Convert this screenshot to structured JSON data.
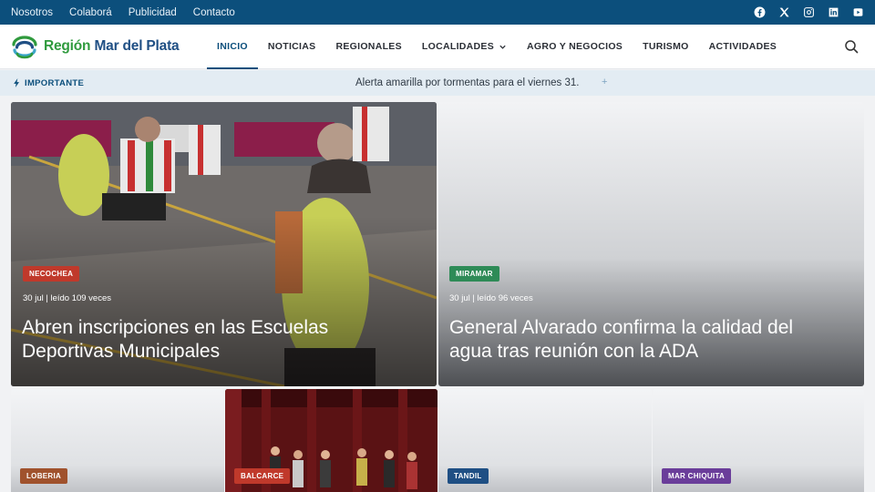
{
  "topbar": {
    "links": [
      "Nosotros",
      "Colaborá",
      "Publicidad",
      "Contacto"
    ],
    "socials": [
      "facebook-icon",
      "x-icon",
      "instagram-icon",
      "linkedin-icon",
      "youtube-icon"
    ]
  },
  "header": {
    "logo_part1": "Región",
    "logo_part2": "Mar del Plata",
    "nav": [
      {
        "label": "INICIO"
      },
      {
        "label": "NOTICIAS"
      },
      {
        "label": "REGIONALES"
      },
      {
        "label": "LOCALIDADES"
      },
      {
        "label": "AGRO Y NEGOCIOS"
      },
      {
        "label": "TURISMO"
      },
      {
        "label": "ACTIVIDADES"
      }
    ]
  },
  "ticker": {
    "label": "IMPORTANTE",
    "text": "Alerta amarilla por tormentas para el viernes 31.",
    "plus": "+"
  },
  "cards": [
    {
      "badge": "NECOCHEA",
      "badge_color": "#c0392b",
      "meta": "30 jul | leído 109 veces",
      "title_line1": "Abren inscripciones en las Escuelas",
      "title_line2": "Deportivas Municipales"
    },
    {
      "badge": "MIRAMAR",
      "badge_color": "#2e8b57",
      "meta": "30 jul | leído 96 veces",
      "title_line1": "General Alvarado confirma la calidad del",
      "title_line2": "agua tras reunión con la ADA"
    },
    {
      "badge": "LOBERIA",
      "badge_color": "#a0522d"
    },
    {
      "badge": "BALCARCE",
      "badge_color": "#c0392b"
    },
    {
      "badge": "TANDIL",
      "badge_color": "#1f4f84"
    },
    {
      "badge": "MAR CHIQUITA",
      "badge_color": "#6a3d9a"
    }
  ],
  "colors": {
    "primary": "#0c4f7c",
    "logo_green": "#2f9a3d",
    "logo_blue": "#1f4f84"
  }
}
